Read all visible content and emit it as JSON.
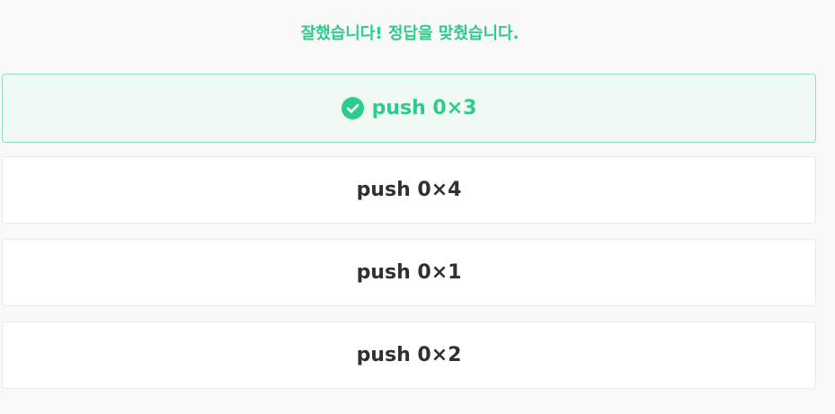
{
  "feedback": {
    "message": "잘했습니다! 정답을 맞췄습니다."
  },
  "options": [
    {
      "label": "push 0×3",
      "state": "correct"
    },
    {
      "label": "push 0×4",
      "state": "default"
    },
    {
      "label": "push 0×1",
      "state": "default"
    },
    {
      "label": "push 0×2",
      "state": "default"
    }
  ],
  "colors": {
    "correct_accent": "#2ecc8a",
    "correct_bg": "#effaf5",
    "correct_border": "#8fe0bd",
    "option_text": "#2f3033",
    "page_bg": "#f9f9f9"
  },
  "icons": {
    "correct_marker": "check-circle-icon"
  }
}
